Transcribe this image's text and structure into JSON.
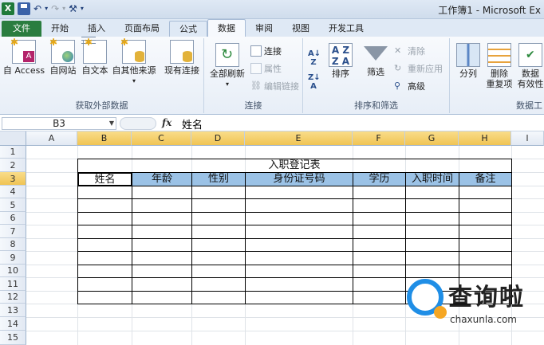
{
  "window": {
    "title": "工作簿1 - Microsoft Ex"
  },
  "tabs": [
    "文件",
    "开始",
    "插入",
    "页面布局",
    "公式",
    "数据",
    "审阅",
    "视图",
    "开发工具"
  ],
  "active_tab": "数据",
  "ribbon": {
    "groups": {
      "external": {
        "label": "获取外部数据",
        "buttons": [
          "自 Access",
          "自网站",
          "自文本",
          "自其他来源",
          "现有连接"
        ]
      },
      "connections": {
        "label": "连接",
        "refresh_all": "全部刷新",
        "small": [
          "连接",
          "属性",
          "编辑链接"
        ]
      },
      "sort_filter": {
        "label": "排序和筛选",
        "sort": "排序",
        "filter": "筛选",
        "small": [
          "清除",
          "重新应用",
          "高级"
        ]
      },
      "data_tools": {
        "label": "数据工",
        "split": "分列",
        "remove_dup_line1": "删除",
        "remove_dup_line2": "重复项",
        "validation_line1": "数据",
        "validation_line2": "有效性"
      }
    }
  },
  "formula_bar": {
    "name_box": "B3",
    "fx": "fx",
    "value": "姓名"
  },
  "sheet": {
    "columns": [
      "A",
      "B",
      "C",
      "D",
      "E",
      "F",
      "G",
      "H",
      "I"
    ],
    "rows": [
      "1",
      "2",
      "3",
      "4",
      "5",
      "6",
      "7",
      "8",
      "9",
      "10",
      "11",
      "12",
      "13",
      "14",
      "15"
    ],
    "table_title": "入职登记表",
    "headers": [
      "姓名",
      "年龄",
      "性别",
      "身份证号码",
      "学历",
      "入职时间",
      "备注"
    ]
  },
  "watermark": {
    "title": "查询啦",
    "subtitle": "chaxunla.com"
  },
  "colors": {
    "header_fill": "#9bc2e6",
    "file_tab": "#2a7d3f",
    "selected_header": "#f0c454"
  }
}
